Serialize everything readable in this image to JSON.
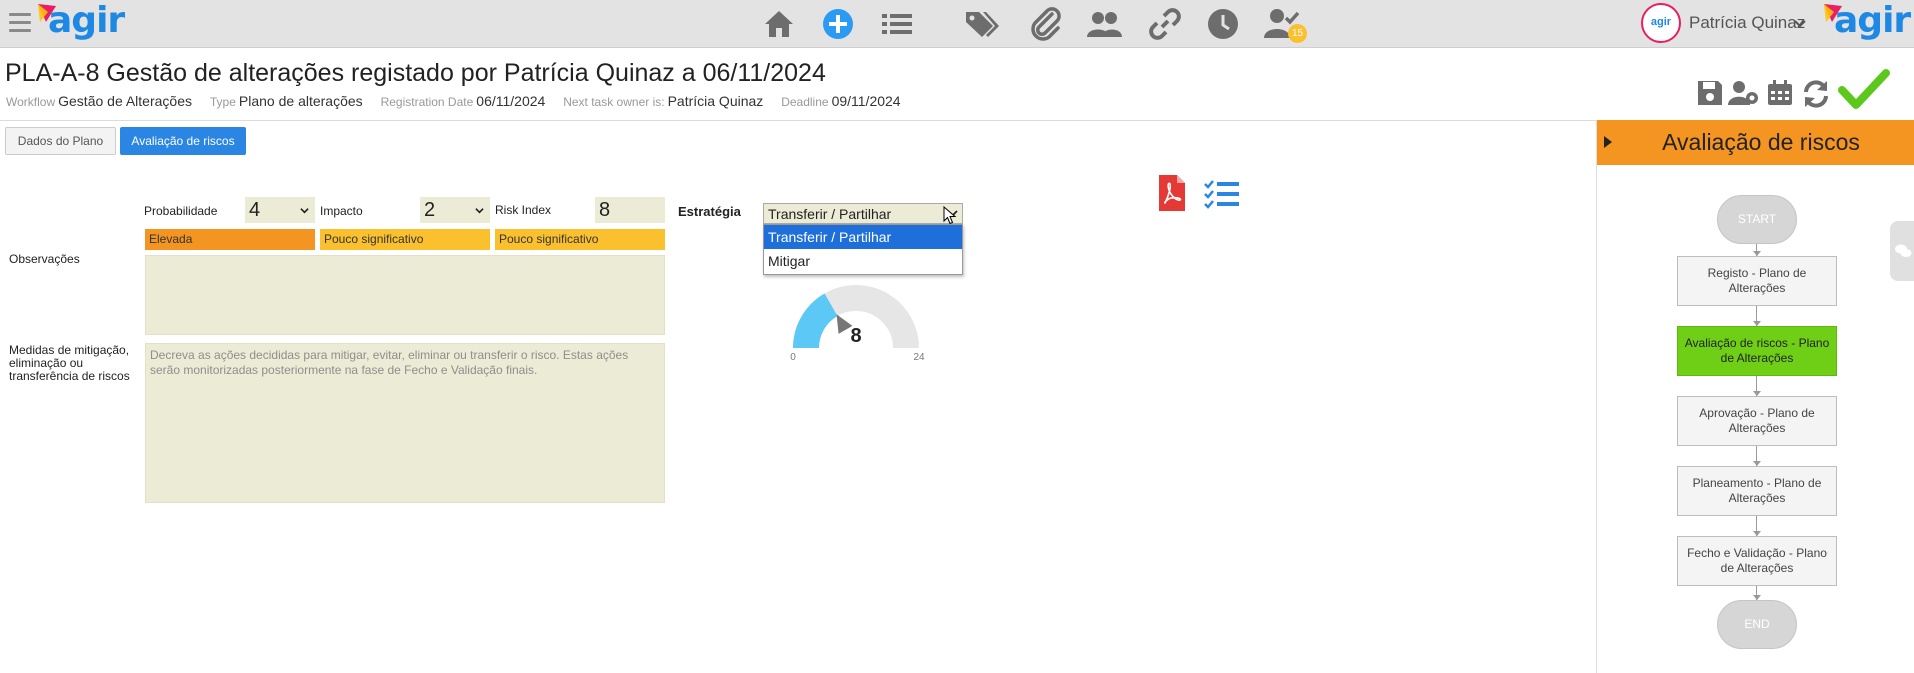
{
  "app": {
    "logo_text": "agir",
    "user_name": "Patrícia Quinaz",
    "notification_count": "15",
    "avatar_label": "agir"
  },
  "nav_icons": [
    "home-icon",
    "add-circle-icon",
    "list-icon",
    "tags-icon",
    "paperclip-icon",
    "users-icon",
    "link-icon",
    "clock-icon",
    "user-check-icon"
  ],
  "header": {
    "title": "PLA-A-8 Gestão de alterações registado por Patrícia Quinaz a 06/11/2024",
    "meta": [
      {
        "label": "Workflow",
        "value": "Gestão de Alterações"
      },
      {
        "label": "Type",
        "value": "Plano de alterações"
      },
      {
        "label": "Registration Date",
        "value": "06/11/2024"
      },
      {
        "label": "Next task owner is:",
        "value": "Patrícia Quinaz"
      },
      {
        "label": "Deadline",
        "value": "09/11/2024"
      }
    ]
  },
  "tabs": [
    {
      "label": "Dados do Plano",
      "active": false
    },
    {
      "label": "Avaliação de riscos",
      "active": true
    }
  ],
  "form": {
    "probabilidade_label": "Probabilidade",
    "probabilidade_value": "4",
    "probabilidade_badge": "Elevada",
    "impacto_label": "Impacto",
    "impacto_value": "2",
    "impacto_badge": "Pouco significativo",
    "risk_index_label": "Risk Index",
    "risk_index_value": "8",
    "risk_index_badge": "Pouco significativo",
    "estrategia_label": "Estratégia",
    "estrategia_value": "Transferir / Partilhar",
    "estrategia_options": [
      "Transferir / Partilhar",
      "Mitigar"
    ],
    "observacoes_label": "Observações",
    "observacoes_value": "",
    "medidas_label": "Medidas de mitigação, eliminação ou transferência de riscos",
    "medidas_placeholder": "Decreva as ações decididas para mitigar, evitar, eliminar ou transferir o risco. Estas ações serão monitorizadas posteriormente na fase de Fecho e Validação finais."
  },
  "gauge": {
    "value": 8,
    "min": 0,
    "max": 24,
    "value_label": "8",
    "min_label": "0",
    "max_label": "24",
    "fill_color": "#5cc8f5",
    "track_color": "#e6e6e6"
  },
  "colors": {
    "accent_blue": "#2b86e3",
    "badge_elevada": "#f39520",
    "badge_pouco": "#fbc02d",
    "panel_orange": "#f39520",
    "active_step": "#6fcf17",
    "check_green": "#5cc81c",
    "pdf_red": "#e53935"
  },
  "workflow": {
    "title": "Avaliação de riscos",
    "start": "START",
    "end": "END",
    "steps": [
      {
        "label": "Registo - Plano de Alterações",
        "active": false
      },
      {
        "label": "Avaliação de riscos - Plano de Alterações",
        "active": true
      },
      {
        "label": "Aprovação - Plano de Alterações",
        "active": false
      },
      {
        "label": "Planeamento - Plano de Alterações",
        "active": false
      },
      {
        "label": "Fecho e Validação - Plano de Alterações",
        "active": false
      }
    ]
  }
}
